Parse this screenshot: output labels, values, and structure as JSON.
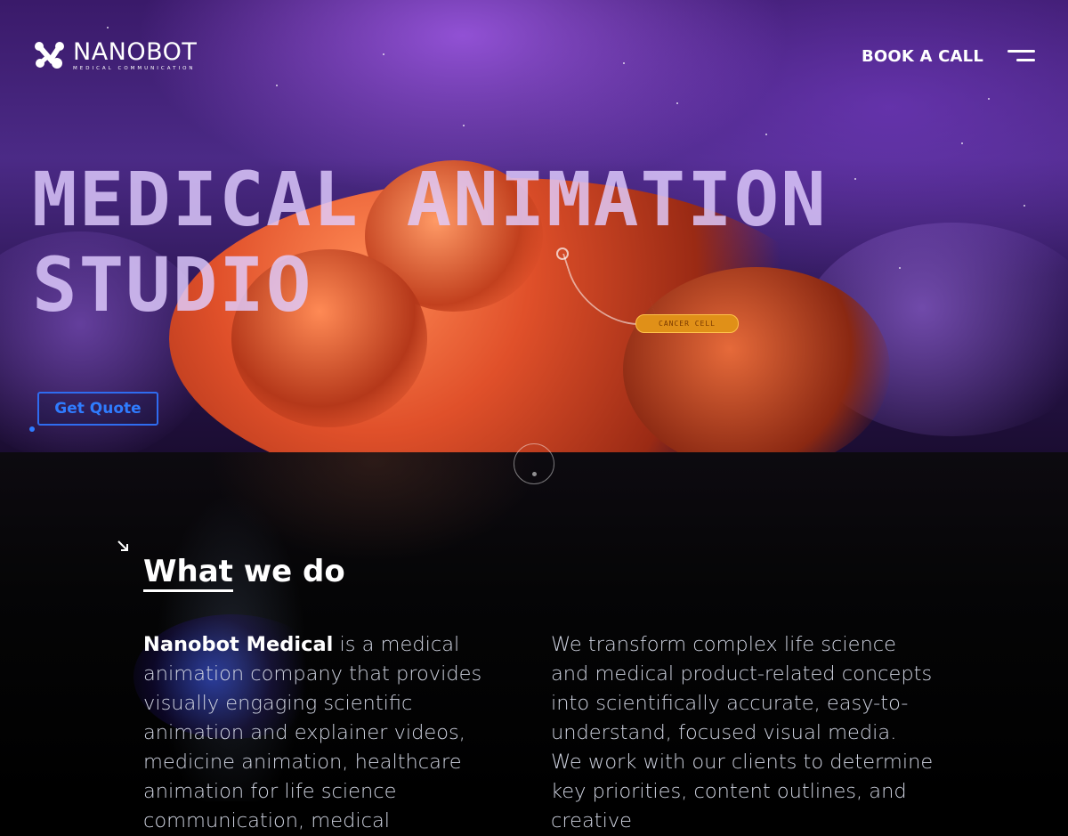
{
  "header": {
    "logo_name": "NANOBOT",
    "logo_tagline": "MEDICAL COMMUNICATION",
    "book_call_label": "BOOK A CALL",
    "menu_icon": "hamburger-menu-icon"
  },
  "hero": {
    "title_line1": "MEDICAL ANIMATION",
    "title_line2": "STUDIO",
    "callout_label": "CANCER CELL",
    "cta_label": "Get Quote"
  },
  "section": {
    "title_underlined": "What",
    "title_rest": " we do",
    "left_strong": "Nanobot Medical",
    "left_text": " is a medical animation company that provides visually engaging scientific animation and explainer videos, medicine animation, healthcare animation for life science communication, medical",
    "right_text": "We transform complex life science and medical product-related concepts into scientifically accurate, easy-to-understand, focused visual media. We work with our clients to determine key priorities, content outlines, and creative"
  },
  "colors": {
    "accent_blue": "#2f7cff",
    "title_lilac": "#e1cdff",
    "callout_orange": "#e09018"
  }
}
